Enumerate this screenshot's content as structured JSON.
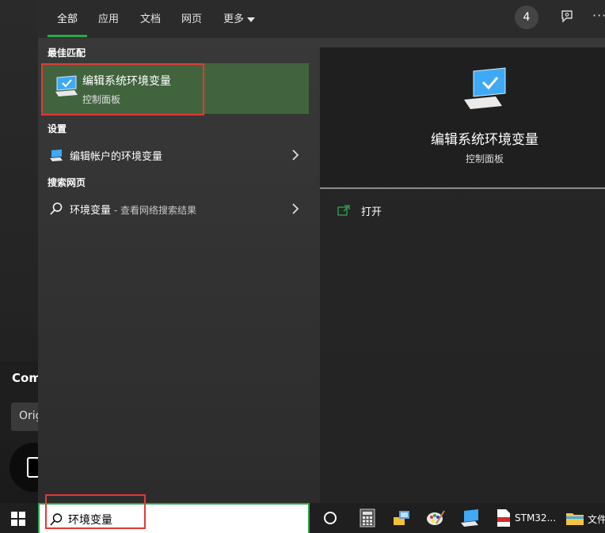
{
  "tabs": {
    "all": "全部",
    "apps": "应用",
    "docs": "文档",
    "web": "网页",
    "more": "更多"
  },
  "header": {
    "badge_count": "4",
    "more_dots": "···"
  },
  "results": {
    "best_match_label": "最佳匹配",
    "best_match": {
      "title": "编辑系统环境变量",
      "subtitle": "控制面板"
    },
    "settings_label": "设置",
    "settings_item": "编辑帐户的环境变量",
    "web_label": "搜索网页",
    "web_item_query": "环境变量",
    "web_item_suffix": " - 查看网络搜索结果"
  },
  "preview": {
    "title": "编辑系统环境变量",
    "subtitle": "控制面板",
    "open_action": "打开"
  },
  "search": {
    "value": "环境变量"
  },
  "background_window": {
    "title": "Com",
    "field": "Orig"
  },
  "taskbar": {
    "stm_label": "STM32...",
    "files_label": "文件"
  },
  "colors": {
    "accent_green": "#2aa84a",
    "best_match_bg": "#41643e",
    "highlight_red": "#e33838"
  }
}
